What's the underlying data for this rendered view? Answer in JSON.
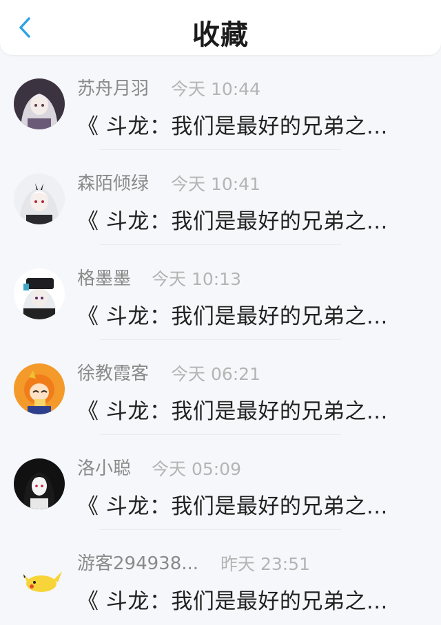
{
  "header": {
    "title": "收藏",
    "back_icon": "chevron-left-icon",
    "accent": "#2aa2e6"
  },
  "items": [
    {
      "name": "苏舟月羽",
      "time": "今天 10:44",
      "content": "《 斗龙：我们是最好的兄弟之...",
      "avatar": "avatar-anime-girl-white-hair"
    },
    {
      "name": "森陌倾绿",
      "time": "今天 10:41",
      "content": "《 斗龙：我们是最好的兄弟之...",
      "avatar": "avatar-anime-girl-horns"
    },
    {
      "name": "格墨墨",
      "time": "今天 10:13",
      "content": "《 斗龙：我们是最好的兄弟之...",
      "avatar": "avatar-anime-girl-cap"
    },
    {
      "name": "徐教霞客",
      "time": "今天 06:21",
      "content": "《 斗龙：我们是最好的兄弟之...",
      "avatar": "avatar-orange-hair-girl"
    },
    {
      "name": "洛小聪",
      "time": "今天 05:09",
      "content": "《 斗龙：我们是最好的兄弟之...",
      "avatar": "avatar-black-white-girl"
    },
    {
      "name": "游客294938...",
      "time": "昨天 23:51",
      "content": "《 斗龙：我们是最好的兄弟之...",
      "avatar": "avatar-pikachu"
    }
  ]
}
